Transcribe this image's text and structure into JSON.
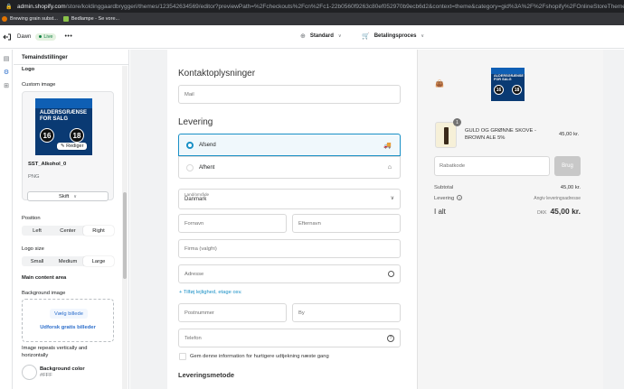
{
  "browser": {
    "url_host": "admin.shopify.com",
    "url_path": "/store/koldinggaardbryggeri/themes/123542634569/editor?previewPath=%2Fcheckouts%2Fcn%2Fc1-22b0560f9263c80ef052970b9ecb6d2&context=theme&category=gid%3A%2F%2Fshopify%2FOnlineStoreThemeSe",
    "bookmarks": [
      {
        "label": "Brewing grain subst...",
        "color": "#e37400"
      },
      {
        "label": "Bedlampe - Se vore...",
        "color": "#8bc34a"
      }
    ]
  },
  "topbar": {
    "theme_name": "Dawn",
    "live_label": "Live",
    "more_label": "•••",
    "template_label": "Standard",
    "page_label": "Betalingsproces"
  },
  "panel": {
    "title": "Temaindstillinger",
    "logo_heading": "Logo",
    "custom_image_label": "Custom image",
    "logo_image_text": "ALDERSGRÆNSE FOR SALG",
    "logo_num_1": "16",
    "logo_num_2": "18",
    "edit_label": "Rediger",
    "file_name": "SST_Alkohol_0",
    "file_type": "PNG",
    "change_label": "Skift",
    "position_label": "Position",
    "position_options": [
      "Left",
      "Center",
      "Right"
    ],
    "position_selected": "Right",
    "logo_size_label": "Logo size",
    "logo_size_options": [
      "Small",
      "Medium",
      "Large"
    ],
    "logo_size_selected": "Large",
    "main_content_heading": "Main content area",
    "bg_image_label": "Background image",
    "select_image_label": "Vælg billede",
    "explore_label": "Udforsk gratis billeder",
    "repeat_note": "Image repeats vertically and horizontally",
    "bg_color_label": "Background color",
    "bg_color_value": "#FFF"
  },
  "checkout": {
    "contact_heading": "Kontaktoplysninger",
    "email_placeholder": "Mail",
    "delivery_heading": "Levering",
    "ship_option_1": "Afsend",
    "ship_option_2": "Afhent",
    "country_label": "Land/område",
    "country_value": "Danmark",
    "first_name": "Fornavn",
    "last_name": "Efternavn",
    "company": "Firma (valgfri)",
    "address": "Adresse",
    "add_apartment": "+ Tilføj lejlighed, etage osv.",
    "postal": "Postnummer",
    "city": "By",
    "phone": "Telefon",
    "save_info": "Gem denne information for hurtigere udtjekning næste gang",
    "shipping_method_heading": "Leveringsmetode"
  },
  "summary": {
    "qty": "1",
    "product_name": "GULD OG GRØNNE SKOVE - BROWN ALE 5%",
    "product_price": "45,00 kr.",
    "discount_placeholder": "Rabatkode",
    "apply_label": "Brug",
    "subtotal_label": "Subtotal",
    "subtotal_value": "45,00 kr.",
    "shipping_label": "Levering",
    "shipping_value": "Angiv leveringsadresse",
    "total_label": "I alt",
    "currency": "DKK",
    "total_value": "45,00 kr."
  }
}
